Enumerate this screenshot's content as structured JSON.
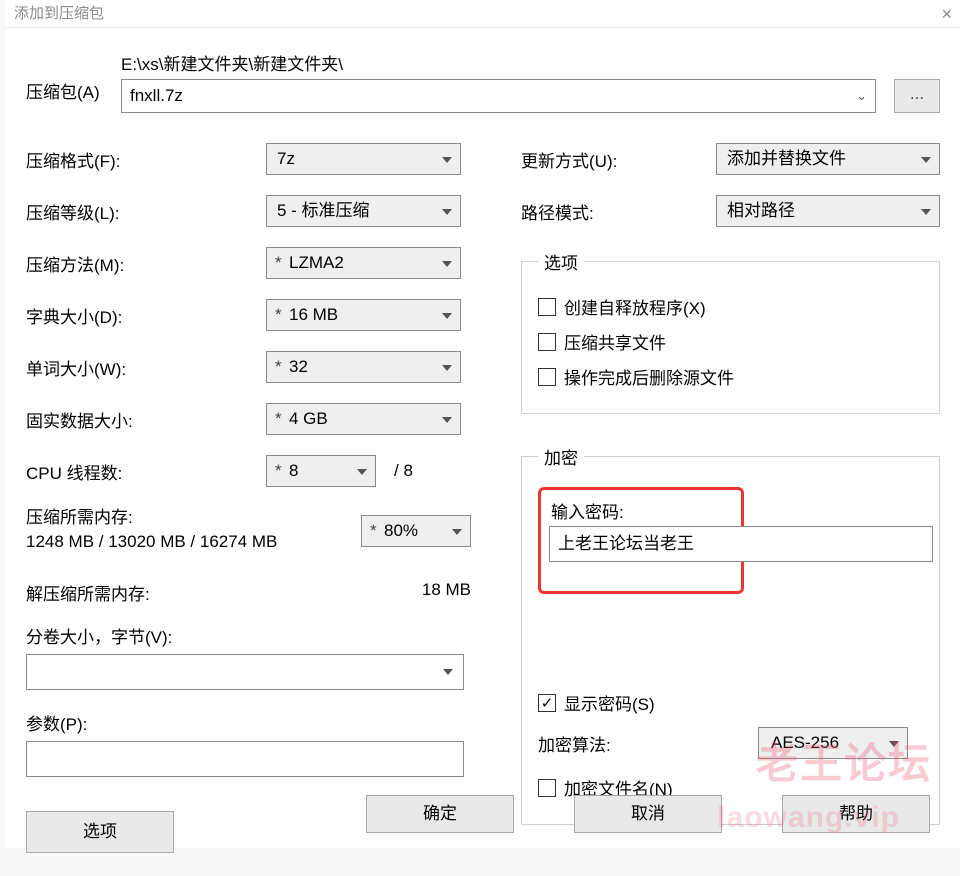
{
  "window": {
    "title": "添加到压缩包",
    "close": "×"
  },
  "archive": {
    "label": "压缩包(A)",
    "path": "E:\\xs\\新建文件夹\\新建文件夹\\",
    "filename": "fnxll.7z",
    "browse": "..."
  },
  "left": {
    "format": {
      "label": "压缩格式(F):",
      "value": "7z"
    },
    "level": {
      "label": "压缩等级(L):",
      "value": "5 - 标准压缩"
    },
    "method": {
      "label": "压缩方法(M):",
      "value": "LZMA2"
    },
    "dict": {
      "label": "字典大小(D):",
      "value": "16 MB"
    },
    "word": {
      "label": "单词大小(W):",
      "value": "32"
    },
    "solid": {
      "label": "固实数据大小:",
      "value": "4 GB"
    },
    "threads": {
      "label": "CPU 线程数:",
      "value": "8",
      "max": "/ 8"
    },
    "mem_compress_label": "压缩所需内存:",
    "mem_compress_value": "1248 MB / 13020 MB / 16274 MB",
    "mem_percent": "80%",
    "mem_decompress_label": "解压缩所需内存:",
    "mem_decompress_value": "18 MB",
    "split_label": "分卷大小，字节(V):",
    "params_label": "参数(P):",
    "options_btn": "选项"
  },
  "right": {
    "update": {
      "label": "更新方式(U):",
      "value": "添加并替换文件"
    },
    "pathmode": {
      "label": "路径模式:",
      "value": "相对路径"
    },
    "options_legend": "选项",
    "opt_sfx": "创建自释放程序(X)",
    "opt_shared": "压缩共享文件",
    "opt_delete": "操作完成后删除源文件",
    "encrypt_legend": "加密",
    "pwd_label": "输入密码:",
    "pwd_value": "上老王论坛当老王",
    "show_pwd": "显示密码(S)",
    "alg_label": "加密算法:",
    "alg_value": "AES-256",
    "enc_names": "加密文件名(N)"
  },
  "buttons": {
    "ok": "确定",
    "cancel": "取消",
    "help": "帮助"
  },
  "watermark": {
    "line1": "老王论坛",
    "line2": "laowang.vip"
  }
}
